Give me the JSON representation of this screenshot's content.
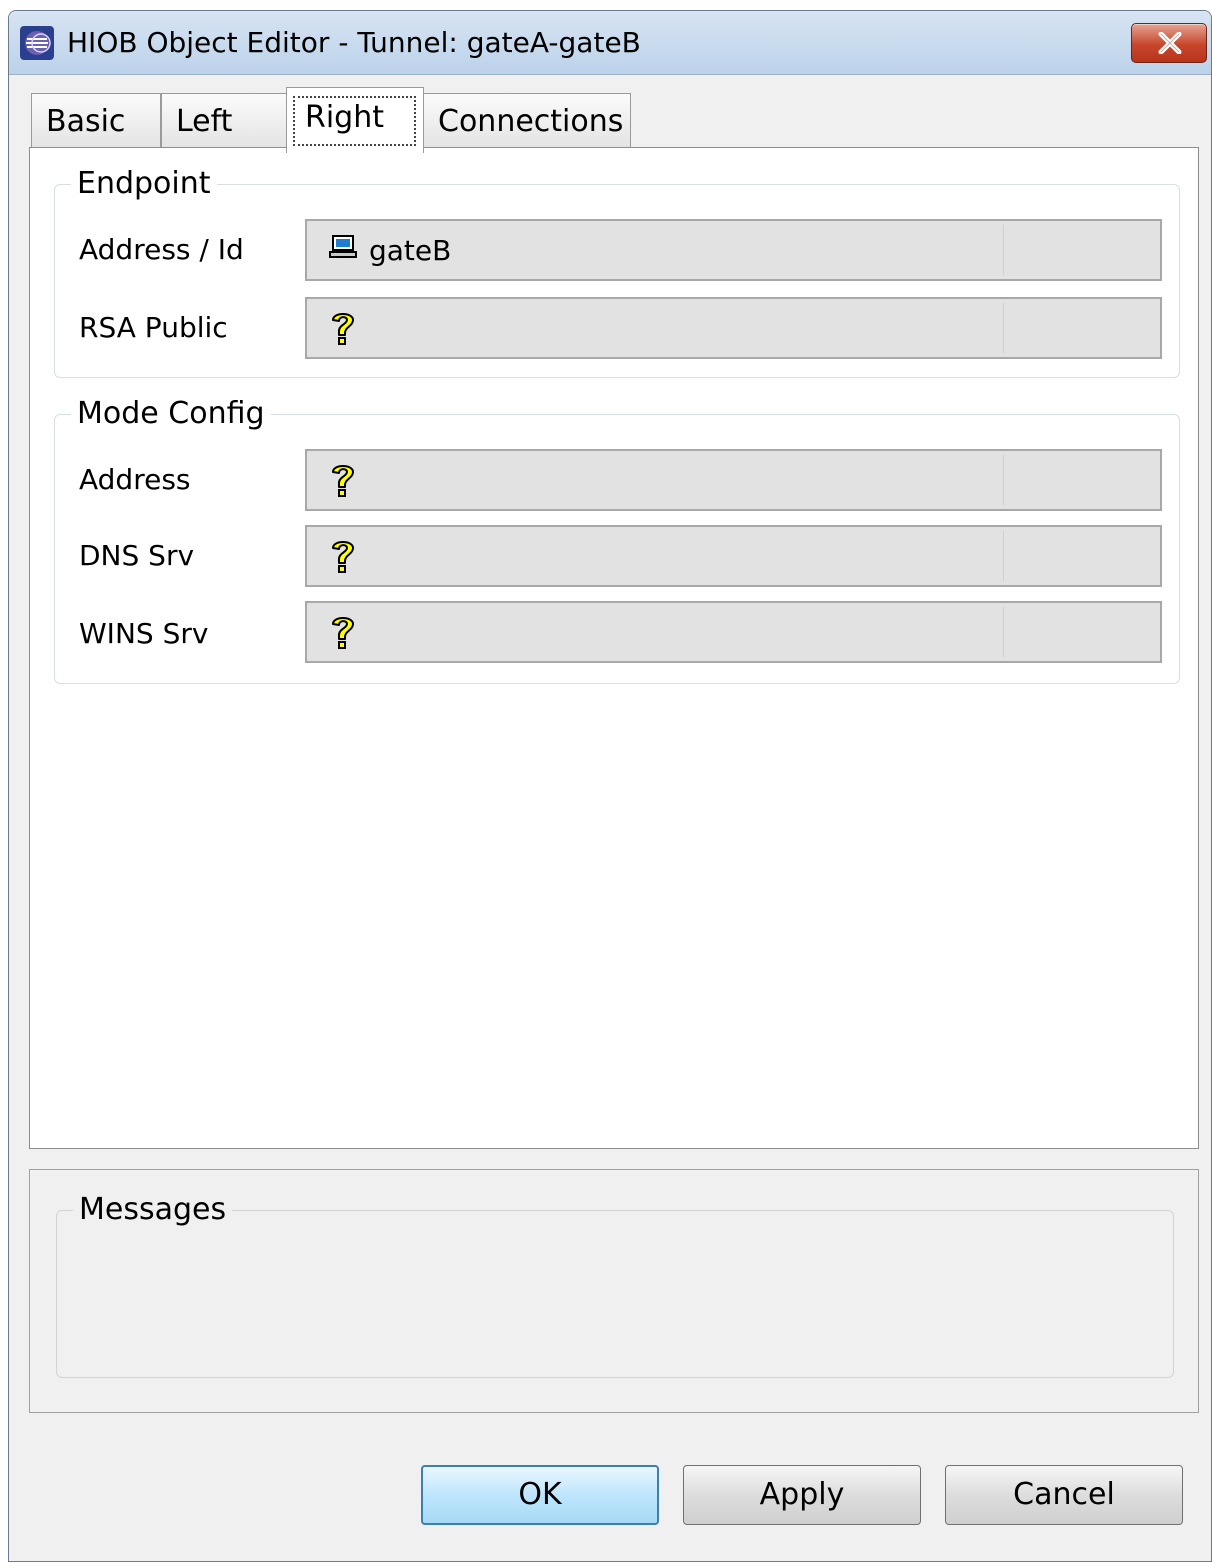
{
  "window": {
    "title": "HIOB Object Editor - Tunnel: gateA-gateB"
  },
  "tabs": [
    {
      "label": "Basic",
      "active": false
    },
    {
      "label": "Left",
      "active": false
    },
    {
      "label": "Right",
      "active": true
    },
    {
      "label": "Connections",
      "active": false
    }
  ],
  "endpoint": {
    "title": "Endpoint",
    "address_label": "Address / Id",
    "address_value": "gateB",
    "address_icon": "computer-icon",
    "rsa_label": "RSA Public",
    "rsa_icon": "question-icon"
  },
  "mode_config": {
    "title": "Mode Config",
    "address_label": "Address",
    "dns_label": "DNS Srv",
    "wins_label": "WINS Srv",
    "field_icon": "question-icon"
  },
  "messages": {
    "title": "Messages"
  },
  "buttons": {
    "ok": "OK",
    "apply": "Apply",
    "cancel": "Cancel"
  },
  "colors": {
    "question_icon": "#ffff00",
    "default_button_border": "#3c7fb1",
    "close_button": "#c7462c"
  }
}
